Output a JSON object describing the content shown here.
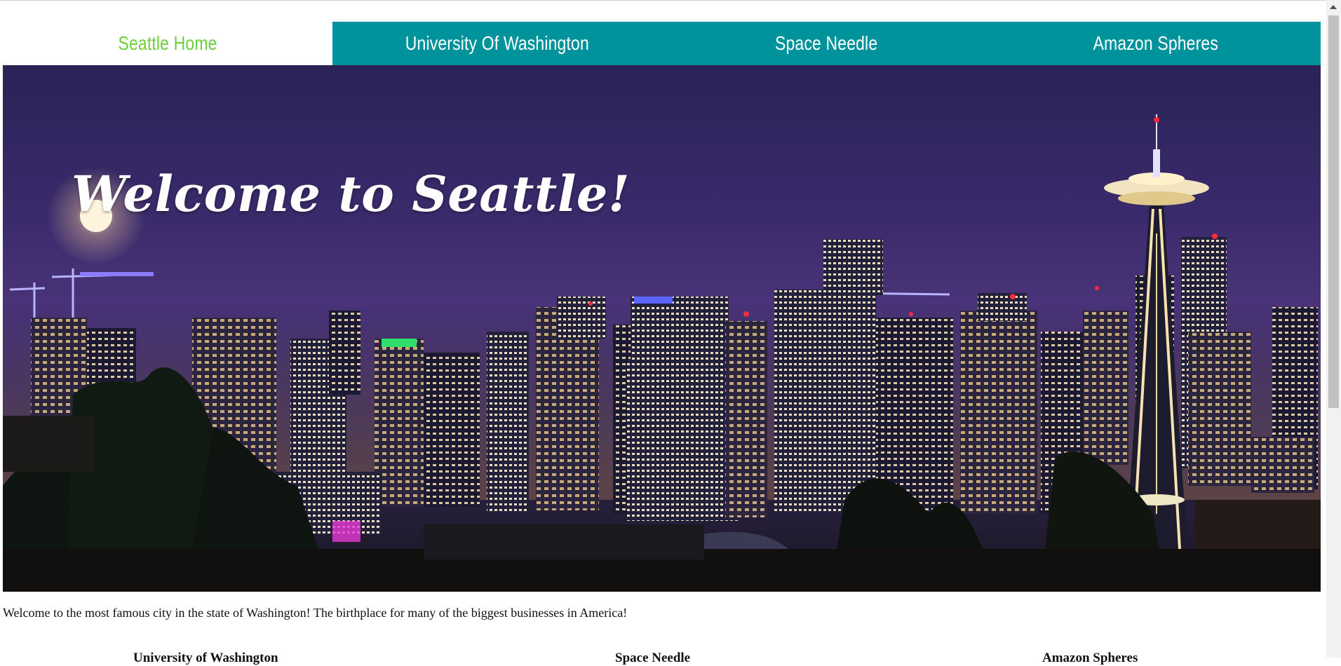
{
  "nav": {
    "tabs": [
      {
        "label": "Seattle Home",
        "active": true
      },
      {
        "label": "University Of Washington",
        "active": false
      },
      {
        "label": "Space Needle",
        "active": false
      },
      {
        "label": "Amazon Spheres",
        "active": false
      }
    ]
  },
  "hero": {
    "title": "Welcome to Seattle!",
    "image_alt": "Seattle skyline at night with the Space Needle and full moon"
  },
  "intro": {
    "text": "Welcome to the most famous city in the state of Washington! The birthplace for many of the biggest businesses in America!"
  },
  "sections": {
    "col1": "University of Washington",
    "col2": "Space Needle",
    "col3": "Amazon Spheres"
  },
  "colors": {
    "nav_bg": "#00939b",
    "active_tab_text": "#6ccf3d",
    "tab_text": "#ffffff"
  }
}
